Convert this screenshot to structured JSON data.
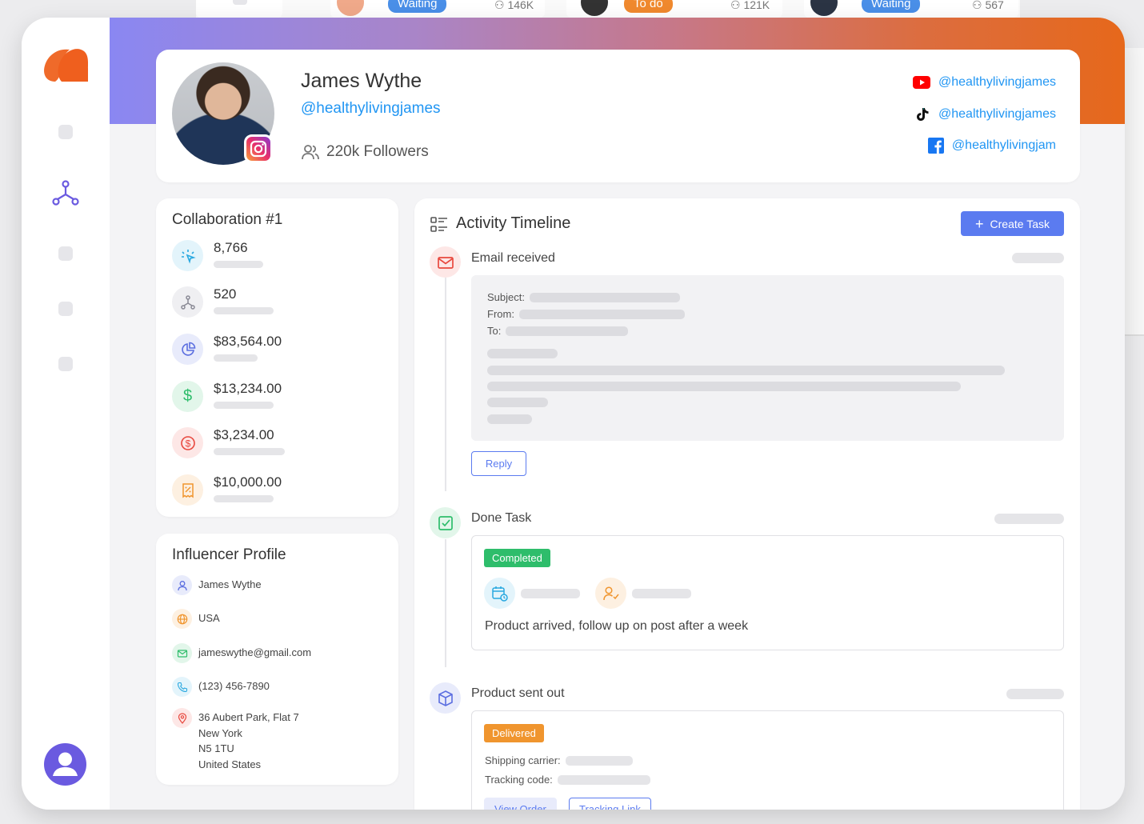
{
  "background": {
    "cards": [
      {
        "status": "Waiting",
        "count": "146K",
        "pill_color": "#4a8fe8"
      },
      {
        "status": "To do",
        "count": "121K",
        "pill_color": "#f0892e"
      },
      {
        "status": "Waiting",
        "count": "567",
        "pill_color": "#4a8fe8"
      }
    ]
  },
  "sidebar": {
    "logo": "brand-logo",
    "items": [
      "nav-item-1",
      "network-icon",
      "nav-item-3",
      "nav-item-4",
      "nav-item-5"
    ]
  },
  "profile": {
    "name": "James Wythe",
    "handle": "@healthylivingjames",
    "followers": "220k Followers",
    "social": [
      {
        "platform": "youtube",
        "handle": "@healthylivingjames"
      },
      {
        "platform": "tiktok",
        "handle": "@healthylivingjames"
      },
      {
        "platform": "facebook",
        "handle": "@healthylivingjam"
      }
    ]
  },
  "collaboration": {
    "title": "Collaboration #1",
    "stats": [
      {
        "icon": "cursor-click-icon",
        "value": "8,766",
        "color": "#29a8e0",
        "bg": "#e3f4fb"
      },
      {
        "icon": "network-icon",
        "value": "520",
        "color": "#8a8a95",
        "bg": "#efeff2"
      },
      {
        "icon": "pie-chart-icon",
        "value": "$83,564.00",
        "color": "#5b6ee0",
        "bg": "#e8ebfb"
      },
      {
        "icon": "dollar-icon",
        "value": "$13,234.00",
        "color": "#2ebd6b",
        "bg": "#e2f6ea"
      },
      {
        "icon": "dollar-circle-icon",
        "value": "$3,234.00",
        "color": "#e8483e",
        "bg": "#fde7e6"
      },
      {
        "icon": "receipt-percent-icon",
        "value": "$10,000.00",
        "color": "#f0952e",
        "bg": "#fdf0e1"
      }
    ]
  },
  "influencer": {
    "title": "Influencer Profile",
    "name": "James Wythe",
    "country": "USA",
    "email": "jameswythe@gmail.com",
    "phone": "(123) 456-7890",
    "address": [
      "36 Aubert Park, Flat 7",
      "New York",
      "N5 1TU",
      "United States"
    ]
  },
  "activity": {
    "title": "Activity Timeline",
    "create_label": "Create Task",
    "events": [
      {
        "label": "Email received",
        "fields": [
          "Subject:",
          "From:",
          "To:"
        ],
        "action": "Reply"
      },
      {
        "label": "Done Task",
        "badge": "Completed",
        "note": "Product arrived, follow up on post after a week"
      },
      {
        "label": "Product sent out",
        "badge": "Delivered",
        "fields": [
          "Shipping carrier:",
          "Tracking code:"
        ],
        "actions": [
          "View Order",
          "Tracking Link"
        ]
      }
    ]
  }
}
